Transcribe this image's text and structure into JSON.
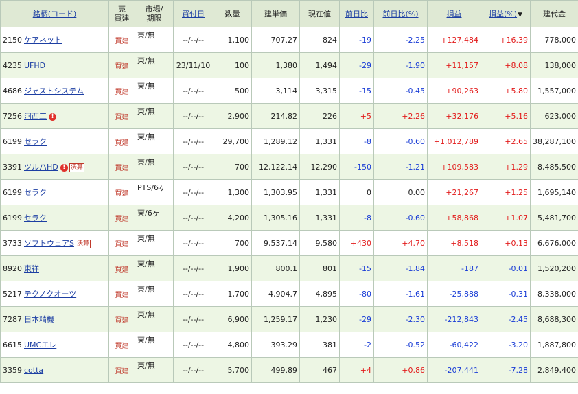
{
  "headers": {
    "name": "銘柄(コード)",
    "side_top": "売",
    "side_bottom": "買建",
    "market_top": "市場/",
    "market_bottom": "期限",
    "date": "買付日",
    "qty": "数量",
    "cost": "建単価",
    "price": "現在値",
    "change": "前日比",
    "change_pct": "前日比(%)",
    "pl": "損益",
    "pl_pct": "損益(%)",
    "sort_mark": "▼",
    "value": "建代金"
  },
  "rows": [
    {
      "code": "2150",
      "name": "ケアネット",
      "alert": "",
      "badge": "",
      "type": "買建",
      "market": "東/無",
      "date": "--/--/--",
      "qty": "1,100",
      "cost": "707.27",
      "price": "824",
      "change": "-19",
      "change_pct": "-2.25",
      "pl": "+127,484",
      "pl_pct": "+16.39",
      "value": "778,000"
    },
    {
      "code": "4235",
      "name": "UFHD",
      "alert": "",
      "badge": "",
      "type": "買建",
      "market": "東/無",
      "date": "23/11/10",
      "qty": "100",
      "cost": "1,380",
      "price": "1,494",
      "change": "-29",
      "change_pct": "-1.90",
      "pl": "+11,157",
      "pl_pct": "+8.08",
      "value": "138,000"
    },
    {
      "code": "4686",
      "name": "ジャストシステム",
      "alert": "",
      "badge": "",
      "type": "買建",
      "market": "東/無",
      "date": "--/--/--",
      "qty": "500",
      "cost": "3,114",
      "price": "3,315",
      "change": "-15",
      "change_pct": "-0.45",
      "pl": "+90,263",
      "pl_pct": "+5.80",
      "value": "1,557,000"
    },
    {
      "code": "7256",
      "name": "河西工",
      "alert": "!",
      "badge": "",
      "type": "買建",
      "market": "東/無",
      "date": "--/--/--",
      "qty": "2,900",
      "cost": "214.82",
      "price": "226",
      "change": "+5",
      "change_pct": "+2.26",
      "pl": "+32,176",
      "pl_pct": "+5.16",
      "value": "623,000"
    },
    {
      "code": "6199",
      "name": "セラク",
      "alert": "",
      "badge": "",
      "type": "買建",
      "market": "東/無",
      "date": "--/--/--",
      "qty": "29,700",
      "cost": "1,289.12",
      "price": "1,331",
      "change": "-8",
      "change_pct": "-0.60",
      "pl": "+1,012,789",
      "pl_pct": "+2.65",
      "value": "38,287,100"
    },
    {
      "code": "3391",
      "name": "ツルハHD",
      "alert": "!",
      "badge": "決算",
      "type": "買建",
      "market": "東/無",
      "date": "--/--/--",
      "qty": "700",
      "cost": "12,122.14",
      "price": "12,290",
      "change": "-150",
      "change_pct": "-1.21",
      "pl": "+109,583",
      "pl_pct": "+1.29",
      "value": "8,485,500"
    },
    {
      "code": "6199",
      "name": "セラク",
      "alert": "",
      "badge": "",
      "type": "買建",
      "market": "PTS/6ヶ",
      "date": "--/--/--",
      "qty": "1,300",
      "cost": "1,303.95",
      "price": "1,331",
      "change": "0",
      "change_pct": "0.00",
      "pl": "+21,267",
      "pl_pct": "+1.25",
      "value": "1,695,140"
    },
    {
      "code": "6199",
      "name": "セラク",
      "alert": "",
      "badge": "",
      "type": "買建",
      "market": "東/6ヶ",
      "date": "--/--/--",
      "qty": "4,200",
      "cost": "1,305.16",
      "price": "1,331",
      "change": "-8",
      "change_pct": "-0.60",
      "pl": "+58,868",
      "pl_pct": "+1.07",
      "value": "5,481,700"
    },
    {
      "code": "3733",
      "name": "ソフトウェアS",
      "alert": "",
      "badge": "決算",
      "type": "買建",
      "market": "東/無",
      "date": "--/--/--",
      "qty": "700",
      "cost": "9,537.14",
      "price": "9,580",
      "change": "+430",
      "change_pct": "+4.70",
      "pl": "+8,518",
      "pl_pct": "+0.13",
      "value": "6,676,000"
    },
    {
      "code": "8920",
      "name": "東祥",
      "alert": "",
      "badge": "",
      "type": "買建",
      "market": "東/無",
      "date": "--/--/--",
      "qty": "1,900",
      "cost": "800.1",
      "price": "801",
      "change": "-15",
      "change_pct": "-1.84",
      "pl": "-187",
      "pl_pct": "-0.01",
      "value": "1,520,200"
    },
    {
      "code": "5217",
      "name": "テクノクオーツ",
      "alert": "",
      "badge": "",
      "type": "買建",
      "market": "東/無",
      "date": "--/--/--",
      "qty": "1,700",
      "cost": "4,904.7",
      "price": "4,895",
      "change": "-80",
      "change_pct": "-1.61",
      "pl": "-25,888",
      "pl_pct": "-0.31",
      "value": "8,338,000"
    },
    {
      "code": "7287",
      "name": "日本精機",
      "alert": "",
      "badge": "",
      "type": "買建",
      "market": "東/無",
      "date": "--/--/--",
      "qty": "6,900",
      "cost": "1,259.17",
      "price": "1,230",
      "change": "-29",
      "change_pct": "-2.30",
      "pl": "-212,843",
      "pl_pct": "-2.45",
      "value": "8,688,300"
    },
    {
      "code": "6615",
      "name": "UMCエレ",
      "alert": "",
      "badge": "",
      "type": "買建",
      "market": "東/無",
      "date": "--/--/--",
      "qty": "4,800",
      "cost": "393.29",
      "price": "381",
      "change": "-2",
      "change_pct": "-0.52",
      "pl": "-60,422",
      "pl_pct": "-3.20",
      "value": "1,887,800"
    },
    {
      "code": "3359",
      "name": "cotta",
      "alert": "",
      "badge": "",
      "type": "買建",
      "market": "東/無",
      "date": "--/--/--",
      "qty": "5,700",
      "cost": "499.89",
      "price": "467",
      "change": "+4",
      "change_pct": "+0.86",
      "pl": "-207,441",
      "pl_pct": "-7.28",
      "value": "2,849,400"
    }
  ],
  "colors": {
    "header_bg": "#dfe9d4",
    "row_alt_bg": "#edf6e4",
    "border": "#b9c9b9",
    "link": "#1d3fa3",
    "positive": "#e21b1b",
    "negative": "#1a3dd6",
    "trade_type": "#c0392b"
  }
}
